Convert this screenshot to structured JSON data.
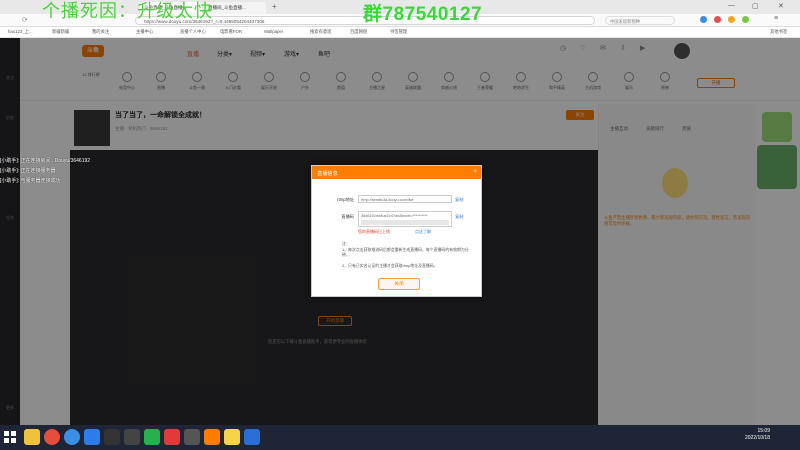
{
  "overlay": {
    "left_text": "个播死因：升级太快",
    "right_text": "群787540127"
  },
  "browser": {
    "tabs": [
      {
        "label": "斗鱼直播_斗鱼直播..."
      },
      {
        "label": "直播间_斗鱼直播..."
      }
    ],
    "url": "https://www.douyu.com/3646192?_r=0.4495054204437306",
    "search_placeholder": "中国发现新物种",
    "bookmarks": [
      "hao123_上...",
      "新疆新疆",
      "我的关注",
      "主播中心",
      "主播个人中心",
      "直播个人中心",
      "电影看FOR",
      "Wallpaper",
      "搜索有意思",
      "百度网盘",
      "万有精选书",
      "书签管理",
      "其他书签"
    ]
  },
  "site": {
    "logo": "斗鱼",
    "nav": [
      "直播",
      "分类▾",
      "视频▾",
      "游戏▾",
      "鱼吧"
    ],
    "nav_right_btn": "开播",
    "categories": [
      "12 排行榜",
      "电竞中心",
      "直播",
      "斗鱼一周",
      "入门必看",
      "娱乐天地",
      "户外",
      "颜值",
      "主播之星",
      "英雄联盟",
      "穿越火线",
      "王者荣耀",
      "绝地求生",
      "和平精英",
      "主机游戏",
      "娱乐",
      "原神",
      "主播招募"
    ],
    "room_title": "当了当了，一命解锁全成就！",
    "room_meta": [
      "主播",
      "单机热门",
      "3646192"
    ],
    "follow_btn": "关注",
    "left_bar": [
      "关注",
      "历史",
      "任务",
      "更多"
    ],
    "right_tabs": [
      "主播互动",
      "贡献排行",
      "贵族"
    ],
    "right_system_text": "斗鱼严禁主播宣扬色情、暴力等违规内容，请文明交流，理性发言，若发现违规可及时举报。",
    "start_btn": "开始直播",
    "stream_hint": "您还可以下载斗鱼直播助手，获得更专业的直播体验"
  },
  "chat_overlay": [
    "[小助手]: 正在连接房间...Douyu/3646192",
    "[小助手]: 正在连接服务器",
    "[小助手]: 与服务器连接成功"
  ],
  "modal": {
    "title": "直播信息",
    "close": "×",
    "rtmp_label": "rtmp地址",
    "rtmp_value": "rtmp://sendtc3a.douyu.com/live",
    "code_label": "直播码",
    "code_value": "3646192rnMueZv4?wsSecret=**********",
    "copy": "复制",
    "warn": "您的直播码已上线",
    "link": "点这了解",
    "notes_title": "注：",
    "notes": [
      "1、每次点击获取推流码后都会重新生成直播码，每个直播码的有效期为分钟。",
      "2、只有已实名认证的主播才会获取rtmp地址及直播码。"
    ],
    "ok": "关闭"
  },
  "taskbar": {
    "time": "15:09",
    "date": "2022/10/18"
  }
}
